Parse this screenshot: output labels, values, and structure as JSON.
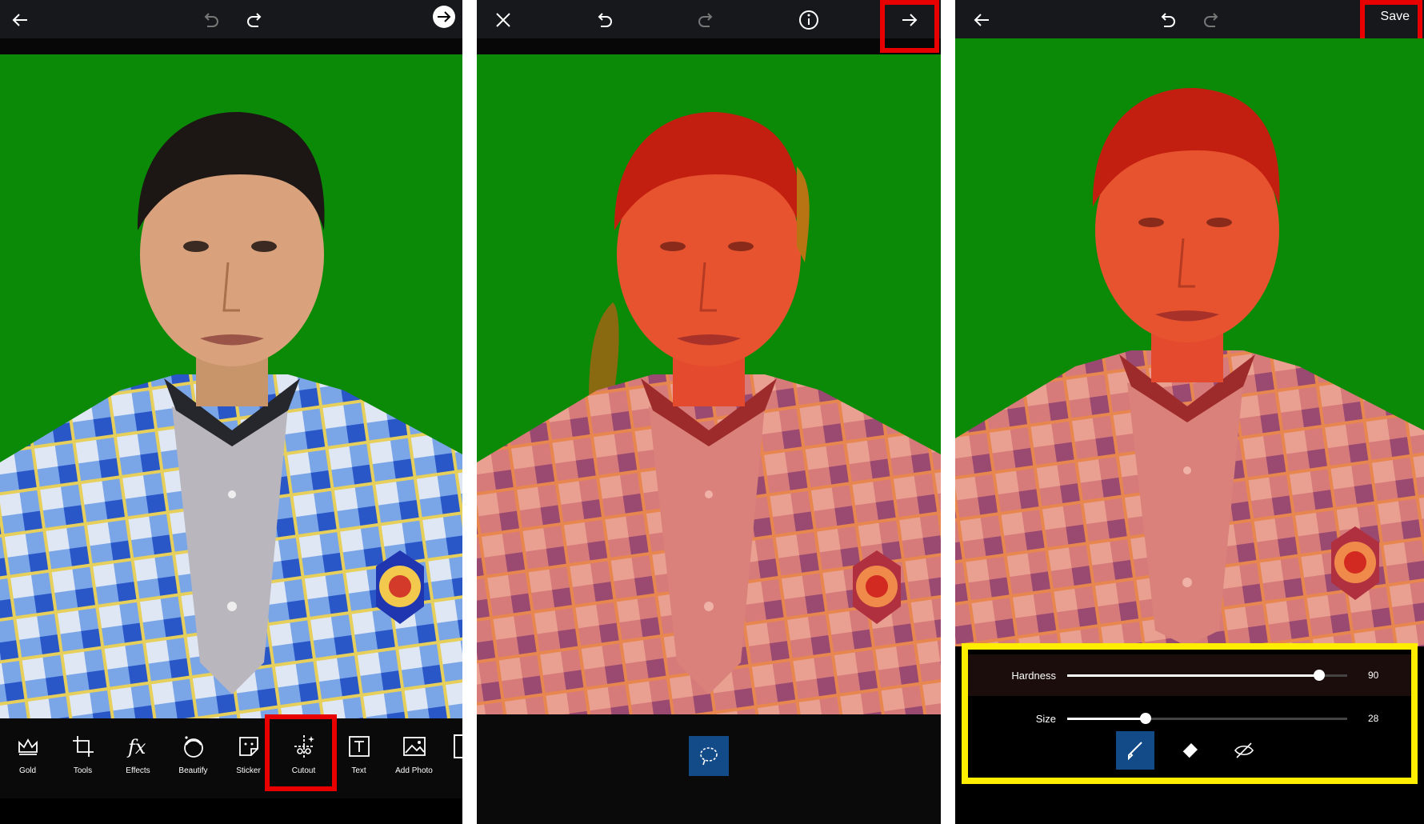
{
  "colors": {
    "background_green": "#088a08",
    "selection_red": "#e53a1c",
    "highlight_red": "#e80000",
    "highlight_yellow": "#ffee00",
    "active_blue": "#134a88"
  },
  "panel1": {
    "icons": [
      "back-arrow-icon",
      "undo-icon",
      "redo-icon",
      "next-circle-arrow-icon"
    ],
    "tools": [
      {
        "label": "Gold",
        "icon": "crown-icon"
      },
      {
        "label": "Tools",
        "icon": "crop-icon"
      },
      {
        "label": "Effects",
        "icon": "fx-icon"
      },
      {
        "label": "Beautify",
        "icon": "face-icon"
      },
      {
        "label": "Sticker",
        "icon": "sticker-icon"
      },
      {
        "label": "Cutout",
        "icon": "scissors-icon"
      },
      {
        "label": "Text",
        "icon": "text-icon"
      },
      {
        "label": "Add Photo",
        "icon": "image-icon"
      }
    ]
  },
  "panel2": {
    "icons": [
      "close-icon",
      "undo-icon",
      "redo-icon",
      "info-icon",
      "forward-arrow-icon"
    ],
    "bottom_tool": "lasso-icon"
  },
  "panel3": {
    "icons": [
      "back-arrow-icon",
      "undo-icon",
      "redo-icon"
    ],
    "save_label": "Save",
    "hardness_label": "Hardness",
    "hardness_value": "90",
    "size_label": "Size",
    "size_value": "28",
    "brush_modes": [
      "brush-icon",
      "eraser-icon",
      "hide-icon"
    ]
  }
}
